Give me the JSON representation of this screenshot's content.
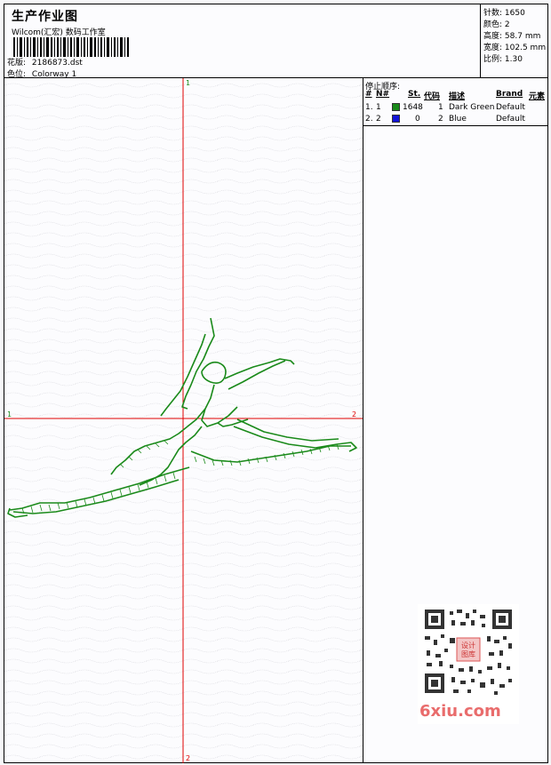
{
  "header": {
    "title": "生产作业图",
    "subtitle": "Wilcom(汇宏) 数码工作室",
    "design_label": "花版:",
    "design_value": "2186873.dst",
    "colorway_label": "色位:",
    "colorway_value": "Colorway 1"
  },
  "stats": [
    {
      "label": "针数:",
      "value": "1650"
    },
    {
      "label": "颜色:",
      "value": "2"
    },
    {
      "label": "高度:",
      "value": "58.7 mm"
    },
    {
      "label": "宽度:",
      "value": "102.5 mm"
    },
    {
      "label": "比例:",
      "value": "1.30"
    }
  ],
  "stops": {
    "heading": "停止顺序:",
    "columns": [
      "#",
      "N#",
      "St.",
      "代码",
      "描述",
      "Brand",
      "元素"
    ],
    "rows": [
      {
        "idx": "1.",
        "n": "1",
        "color": "#1a8a1a",
        "stitches": "1648",
        "code": "1",
        "desc": "Dark Green",
        "brand": "Default"
      },
      {
        "idx": "2.",
        "n": "2",
        "color": "#1414d8",
        "stitches": "0",
        "code": "2",
        "desc": "Blue",
        "brand": "Default"
      }
    ]
  },
  "axes": {
    "top": "1",
    "bottom": "2",
    "left": "1",
    "right": "2",
    "color": "#e00000"
  },
  "embroidery_color": "#1a8a1a",
  "watermark": {
    "text": "6xiu.com",
    "seal": "设计图库"
  }
}
